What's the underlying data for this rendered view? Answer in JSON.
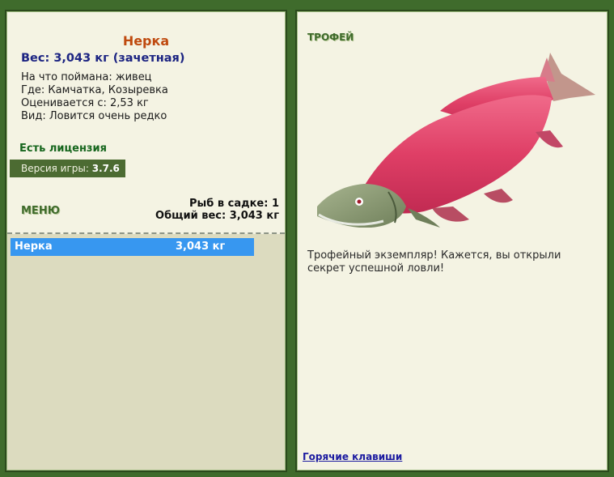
{
  "fish": {
    "title": "Нерка",
    "weight_line": "Вес: 3,043 кг (зачетная)",
    "bait_line": "На что поймана: живец",
    "place_line": "Где: Камчатка, Козыревка",
    "estimate_line": "Оценивается с: 2,53 кг",
    "kind_line": "Вид: Ловится очень редко"
  },
  "license": "Есть лицензия",
  "version": {
    "label": "Версия игры: ",
    "value": "3.7.6"
  },
  "menu_label": "МЕНЮ",
  "keepnet": {
    "count_text": "Рыб в садке: 1",
    "total_text": "Общий вес: 3,043 кг"
  },
  "catch_list": [
    {
      "name": "Нерка",
      "weight": "3,043 кг"
    }
  ],
  "trophy": {
    "label": "ТРОФЕЙ",
    "text": "Трофейный экземпляр! Кажется, вы открыли секрет успешной ловли!"
  },
  "hotkeys_link": "Горячие клавиши",
  "colors": {
    "background": "#3f6b2c",
    "panel_light": "#f4f3e3",
    "panel_dark": "#dcdbbf",
    "selected_row": "#3797f0",
    "fish_title": "#bf4a0f",
    "weight_text": "#1c2482",
    "license_text": "#16661d",
    "fish_body": "#e0436a",
    "fish_head": "#8ea07a"
  },
  "icons": {
    "fish_image": "sockeye-salmon-image"
  }
}
